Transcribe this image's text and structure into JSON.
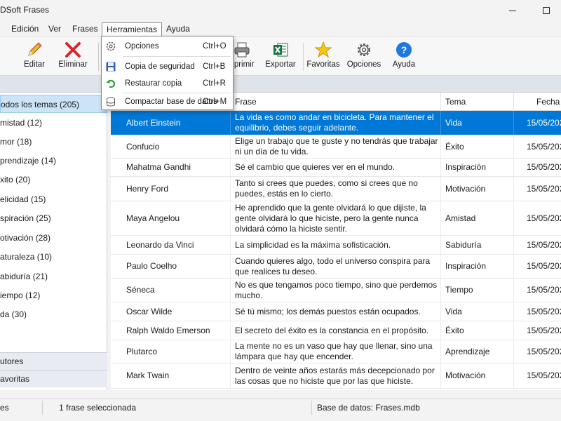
{
  "window": {
    "title": "DSoft Frases"
  },
  "menubar": [
    "Edición",
    "Ver",
    "Frases",
    "Herramientas",
    "Ayuda"
  ],
  "toolbar": {
    "editar": "Editar",
    "eliminar": "Eliminar",
    "imprimir": "nprimir",
    "exportar": "Exportar",
    "favoritas": "Favoritas",
    "opciones": "Opciones",
    "ayuda": "Ayuda"
  },
  "dropdown": {
    "items": [
      {
        "label": "Opciones",
        "shortcut": "Ctrl+O",
        "icon": "gear-icon"
      },
      {
        "label": "Copia de seguridad",
        "shortcut": "Ctrl+B",
        "icon": "floppy-icon"
      },
      {
        "label": "Restaurar copia",
        "shortcut": "Ctrl+R",
        "icon": "undo-icon"
      },
      {
        "label": "Compactar base de datos",
        "shortcut": "Ctrl+M",
        "icon": "database-icon"
      }
    ]
  },
  "sidebar": {
    "items": [
      "odos los temas (205)",
      "mistad (12)",
      "mor (18)",
      "prendizaje (14)",
      "xito (20)",
      "elicidad (15)",
      "spiración (25)",
      "otivación (28)",
      "aturaleza (10)",
      "abiduría (21)",
      "iempo (12)",
      "da (30)"
    ],
    "bottom": [
      "utores",
      "avoritas"
    ]
  },
  "table": {
    "headers": {
      "frase": "Frase",
      "tema": "Tema",
      "fecha": "Fecha"
    },
    "rows": [
      {
        "autor": "Albert Einstein",
        "frase": "La vida es como andar en bicicleta. Para mantener el equilibrio, debes seguir adelante.",
        "tema": "Vida",
        "fecha": "15/05/202"
      },
      {
        "autor": "Confucio",
        "frase": "Elige un trabajo que te guste y no tendrás que trabajar ni un día de tu vida.",
        "tema": "Éxito",
        "fecha": "15/05/202"
      },
      {
        "autor": "Mahatma Gandhi",
        "frase": "Sé el cambio que quieres ver en el mundo.",
        "tema": "Inspiración",
        "fecha": "15/05/202"
      },
      {
        "autor": "Henry Ford",
        "frase": "Tanto si crees que puedes, como si crees que no puedes, estás en lo cierto.",
        "tema": "Motivación",
        "fecha": "15/05/202"
      },
      {
        "autor": "Maya Angelou",
        "frase": "He aprendido que la gente olvidará lo que dijiste, la gente olvidará lo que hiciste, pero la gente nunca olvidará cómo la hiciste sentir.",
        "tema": "Amistad",
        "fecha": "15/05/202"
      },
      {
        "autor": "Leonardo da Vinci",
        "frase": "La simplicidad es la máxima sofisticación.",
        "tema": "Sabiduría",
        "fecha": "15/05/202"
      },
      {
        "autor": "Paulo Coelho",
        "frase": "Cuando quieres algo, todo el universo conspira para que realices tu deseo.",
        "tema": "Inspiración",
        "fecha": "15/05/202"
      },
      {
        "autor": "Séneca",
        "frase": "No es que tengamos poco tiempo, sino que perdemos mucho.",
        "tema": "Tiempo",
        "fecha": "15/05/202"
      },
      {
        "autor": "Oscar Wilde",
        "frase": "Sé tú mismo; los demás puestos están ocupados.",
        "tema": "Vida",
        "fecha": "15/05/202"
      },
      {
        "autor": "Ralph Waldo Emerson",
        "frase": "El secreto del éxito es la constancia en el propósito.",
        "tema": "Éxito",
        "fecha": "15/05/202"
      },
      {
        "autor": "Plutarco",
        "frase": "La mente no es un vaso que hay que llenar, sino una lámpara que hay que encender.",
        "tema": "Aprendizaje",
        "fecha": "15/05/202"
      },
      {
        "autor": "Mark Twain",
        "frase": "Dentro de veinte años estarás más decepcionado por las cosas que no hiciste que por las que hiciste.",
        "tema": "Motivación",
        "fecha": "15/05/202"
      }
    ]
  },
  "statusbar": {
    "left": "es",
    "selection": "1 frase seleccionada",
    "database": "Base de datos: Frases.mdb"
  },
  "colors": {
    "accent": "#0078d7",
    "sidebar_selected": "#cce4f7"
  }
}
